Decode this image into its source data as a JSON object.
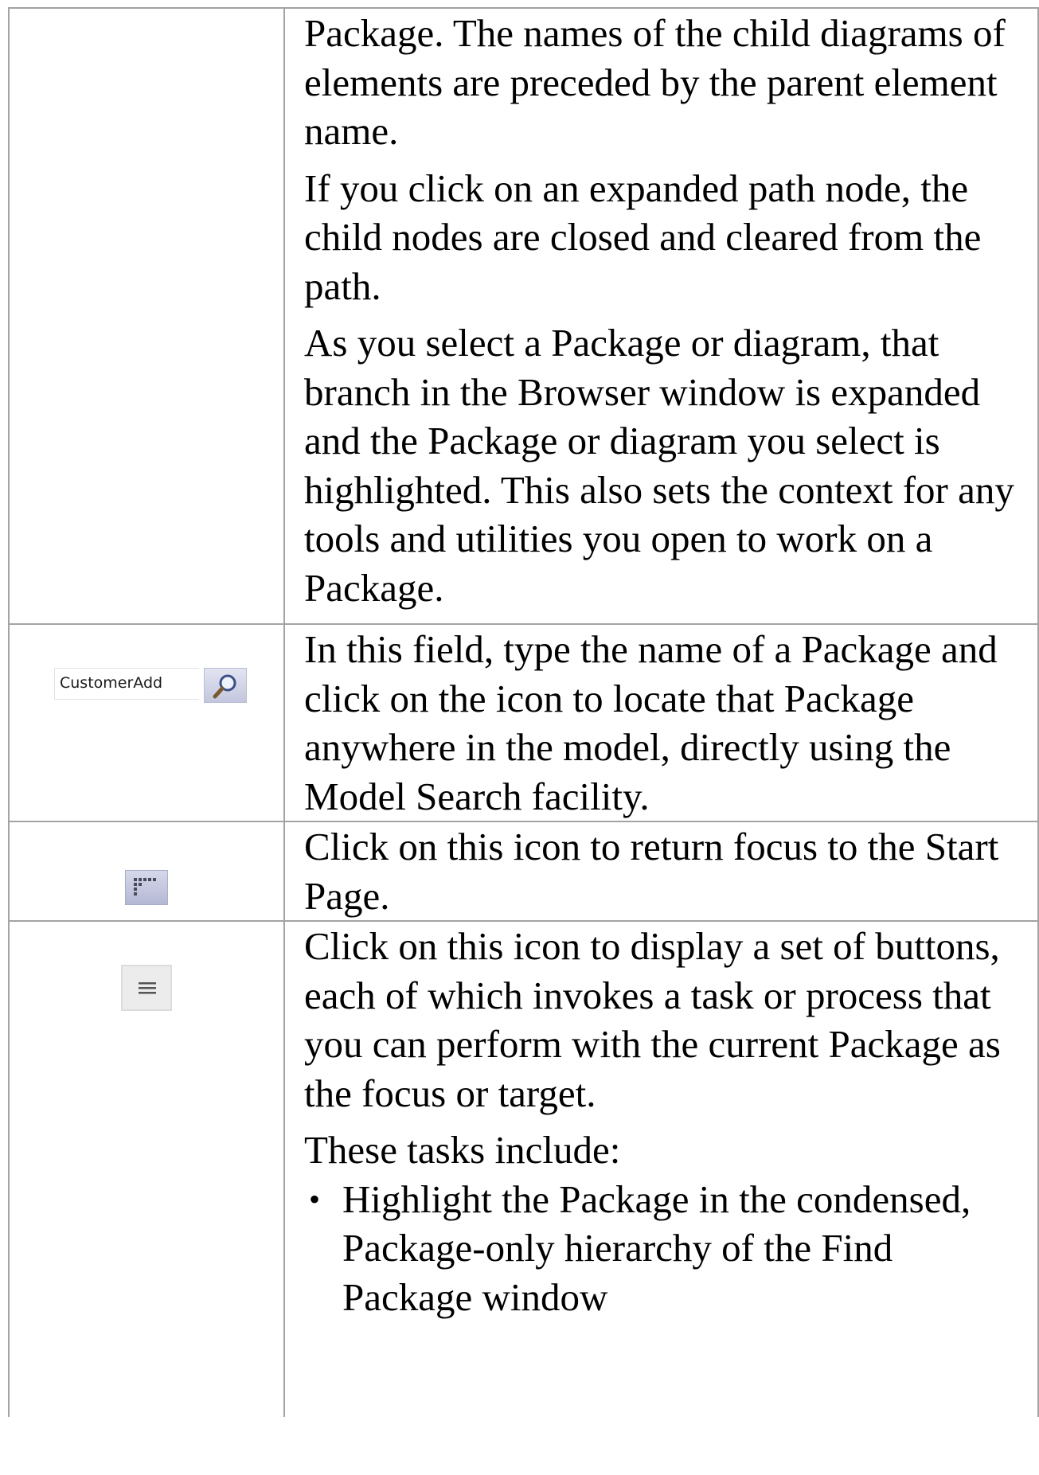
{
  "rows": [
    {
      "paragraphs": [
        "Package. The names of the child diagrams of elements are preceded by the parent element name.",
        "If you click on an expanded path node, the child nodes are closed and cleared from the path.",
        "As you select a Package or diagram, that branch in the Browser window is expanded and the Package or diagram you select is highlighted. This also sets the context for any tools and utilities you open to work on a Package."
      ]
    },
    {
      "icon": "search-field-with-magnifier-icon",
      "search_value": "CustomerAdd",
      "paragraphs": [
        "In this field, type the name of a Package and click on the icon to locate that Package anywhere in the model, directly using the Model Search facility."
      ]
    },
    {
      "icon": "start-page-icon",
      "paragraphs": [
        "Click on this icon to return focus to the Start Page."
      ]
    },
    {
      "icon": "menu-icon",
      "paragraphs": [
        "Click on this icon to display a set of buttons, each of which invokes a task or process that you can perform with the current Package as the focus or target.",
        "These tasks include:"
      ],
      "bullets": [
        "Highlight the Package in the condensed, Package-only hierarchy of the Find Package window"
      ]
    }
  ],
  "colors": {
    "border": "#a3a3a3",
    "icon_accent": "#b4b8d3"
  }
}
